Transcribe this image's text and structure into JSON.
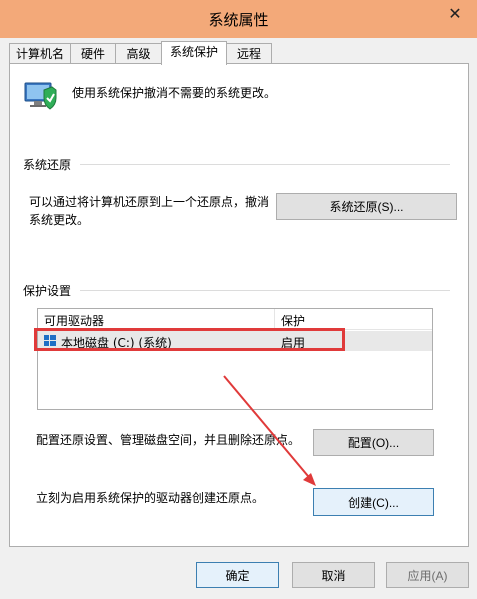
{
  "window": {
    "title": "系统属性",
    "close_glyph": "✕"
  },
  "tabs": [
    {
      "label": "计算机名",
      "active": false
    },
    {
      "label": "硬件",
      "active": false
    },
    {
      "label": "高级",
      "active": false
    },
    {
      "label": "系统保护",
      "active": true
    },
    {
      "label": "远程",
      "active": false
    }
  ],
  "intro": {
    "text": "使用系统保护撤消不需要的系统更改。",
    "icon": "computer-shield-icon"
  },
  "restore": {
    "group_label": "系统还原",
    "description_line1": "可以通过将计算机还原到上一个还原点，撤消",
    "description_line2": "系统更改。",
    "button_label": "系统还原(S)..."
  },
  "protection": {
    "group_label": "保护设置",
    "columns": [
      "可用驱动器",
      "保护"
    ],
    "rows": [
      {
        "drive": "本地磁盘 (C:) (系统)",
        "status": "启用",
        "icon": "windows-drive-icon"
      }
    ],
    "configure_text": "配置还原设置、管理磁盘空间，并且删除还原点。",
    "configure_button": "配置(O)...",
    "create_text": "立刻为启用系统保护的驱动器创建还原点。",
    "create_button": "创建(C)..."
  },
  "footer": {
    "ok": "确定",
    "cancel": "取消",
    "apply": "应用(A)"
  },
  "annotation": {
    "highlight_color": "#e03a3a",
    "arrow_color": "#e03a3a"
  },
  "colors": {
    "titlebar": "#f3a979",
    "panel": "#ffffff",
    "dialog": "#f0f0f0"
  }
}
